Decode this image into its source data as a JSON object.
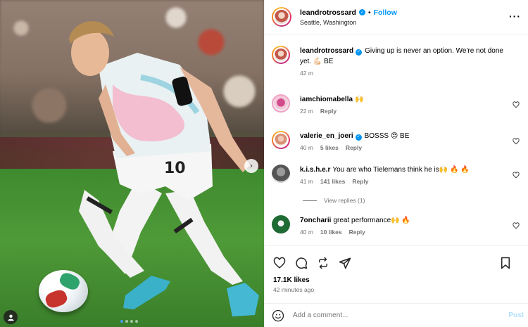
{
  "post": {
    "username": "leandrotrossard",
    "follow_label": "Follow",
    "separator": "•",
    "location": "Seattle, Washington",
    "more_label": "···"
  },
  "caption": {
    "username": "leandrotrossard",
    "text": "Giving up is never an option. We're not done yet. 💪🏻 BE",
    "time": "42 m"
  },
  "comments": [
    {
      "username": "iamchiomabella",
      "text": "🙌",
      "time": "22 m",
      "likes": "",
      "reply": "Reply",
      "verified": false
    },
    {
      "username": "valerie_en_joeri",
      "text": "BOSSS 😍 BE",
      "time": "40 m",
      "likes": "5 likes",
      "reply": "Reply",
      "verified": true
    },
    {
      "username": "k.i.s.h.e.r",
      "text": "You are who Tielemans think he is🙌 🔥 🔥",
      "time": "41 m",
      "likes": "141 likes",
      "reply": "Reply",
      "verified": false
    },
    {
      "username": "7oncharii",
      "text": "great performance🙌 🔥",
      "time": "40 m",
      "likes": "10 likes",
      "reply": "Reply",
      "verified": false
    }
  ],
  "view_replies": "View replies (1)",
  "footer": {
    "likes": "17.1K likes",
    "ago": "42 minutes ago",
    "comment_placeholder": "Add a comment...",
    "post_label": "Post"
  },
  "carousel": {
    "total": 4,
    "active": 1
  },
  "colors": {
    "link": "#0095f6",
    "muted": "#737373",
    "border": "#efefef"
  },
  "icons": [
    "heart-icon",
    "comment-icon",
    "share-icon",
    "send-icon",
    "bookmark-icon",
    "emoji-icon",
    "tag-person-icon",
    "chevron-right-icon"
  ]
}
